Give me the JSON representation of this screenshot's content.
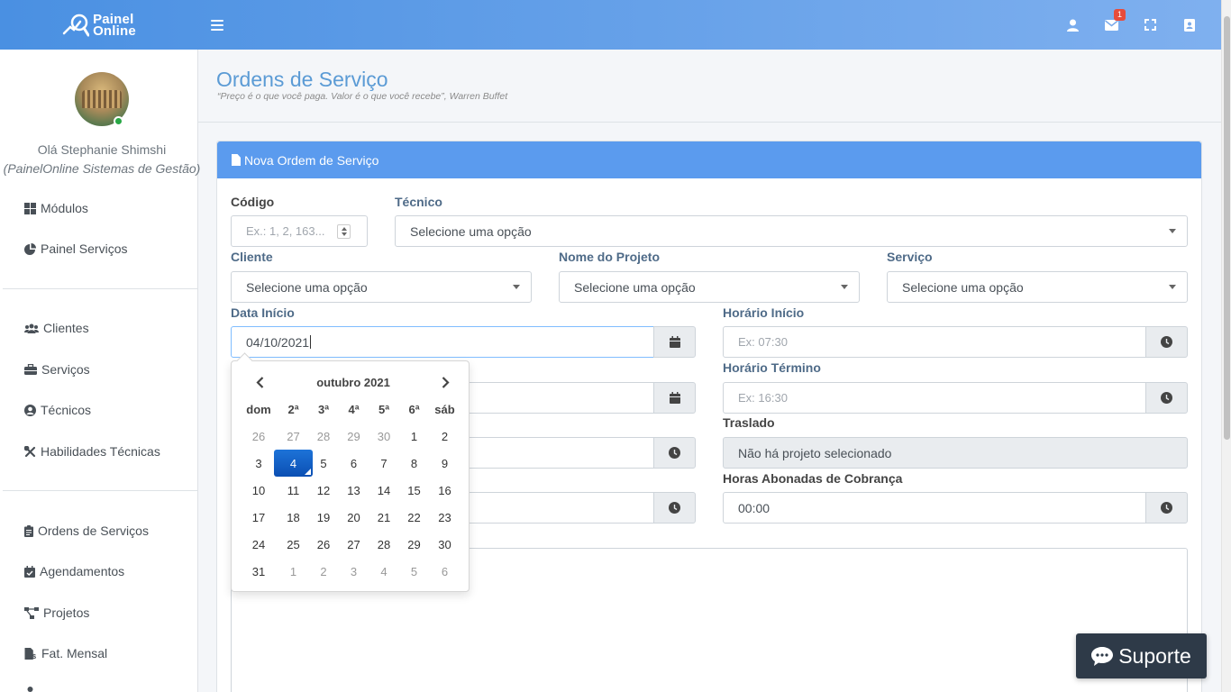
{
  "navbar": {
    "brand_line1": "Painel",
    "brand_line2": "Online",
    "notification_count": "1"
  },
  "sidebar": {
    "greeting": "Olá Stephanie Shimshi",
    "company": "(PainelOnline Sistemas de Gestão)",
    "items": [
      {
        "label": "Módulos",
        "icon": "grid-icon"
      },
      {
        "label": "Painel Serviços",
        "icon": "pie-chart-icon"
      },
      {
        "label": "Clientes",
        "icon": "users-icon"
      },
      {
        "label": "Serviços",
        "icon": "briefcase-icon"
      },
      {
        "label": "Técnicos",
        "icon": "user-circle-icon"
      },
      {
        "label": "Habilidades Técnicas",
        "icon": "tools-icon"
      },
      {
        "label": "Ordens de Serviços",
        "icon": "clipboard-icon"
      },
      {
        "label": "Agendamentos",
        "icon": "calendar-check-icon"
      },
      {
        "label": "Projetos",
        "icon": "project-diagram-icon"
      },
      {
        "label": "Fat. Mensal",
        "icon": "file-invoice-icon"
      }
    ]
  },
  "header": {
    "title": "Ordens de Serviço",
    "quote": "“Preço é o que você paga. Valor é o que você recebe”, Warren Buffet"
  },
  "card": {
    "title": "Nova Ordem de Serviço"
  },
  "form": {
    "codigo_label": "Código",
    "codigo_placeholder": "Ex.: 1, 2, 163...",
    "tecnico_label": "Técnico",
    "tecnico_value": "Selecione uma opção",
    "cliente_label": "Cliente",
    "cliente_value": "Selecione uma opção",
    "projeto_label": "Nome do Projeto",
    "projeto_value": "Selecione uma opção",
    "servico_label": "Serviço",
    "servico_value": "Selecione uma opção",
    "data_inicio_label": "Data Início",
    "data_inicio_value": "04/10/2021",
    "horario_inicio_label": "Horário Início",
    "horario_inicio_placeholder": "Ex: 07:30",
    "horario_termino_label": "Horário Término",
    "horario_termino_placeholder": "Ex: 16:30",
    "traslado_label": "Traslado",
    "traslado_value": "Não há projeto selecionado",
    "horas_abonadas_label": "Horas Abonadas de Cobrança",
    "horas_abonadas_value": "00:00"
  },
  "datepicker": {
    "title": "outubro 2021",
    "weekdays": [
      "dom",
      "2ª",
      "3ª",
      "4ª",
      "5ª",
      "6ª",
      "sáb"
    ],
    "weeks": [
      [
        "26",
        "27",
        "28",
        "29",
        "30",
        "1",
        "2"
      ],
      [
        "3",
        "4",
        "5",
        "6",
        "7",
        "8",
        "9"
      ],
      [
        "10",
        "11",
        "12",
        "13",
        "14",
        "15",
        "16"
      ],
      [
        "17",
        "18",
        "19",
        "20",
        "21",
        "22",
        "23"
      ],
      [
        "24",
        "25",
        "26",
        "27",
        "28",
        "29",
        "30"
      ],
      [
        "31",
        "1",
        "2",
        "3",
        "4",
        "5",
        "6"
      ]
    ],
    "selected_day": "4"
  },
  "support": {
    "label": "Suporte"
  },
  "colors": {
    "accent": "#5b9bee",
    "title": "#5b9bd5",
    "support_bg": "#2e3a48",
    "selected_day": "#1d73d8",
    "badge": "#e74c3c"
  }
}
